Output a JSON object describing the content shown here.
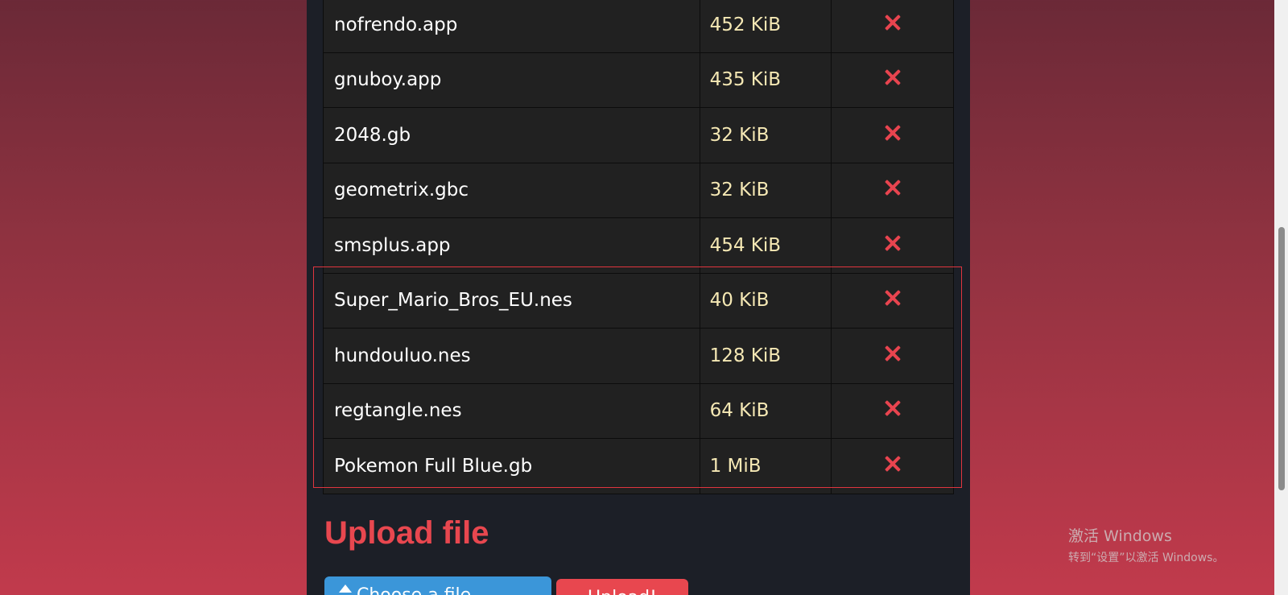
{
  "files": [
    {
      "name": "nofrendo.app",
      "size": "452 KiB"
    },
    {
      "name": "gnuboy.app",
      "size": "435 KiB"
    },
    {
      "name": "2048.gb",
      "size": "32 KiB"
    },
    {
      "name": "geometrix.gbc",
      "size": "32 KiB"
    },
    {
      "name": "smsplus.app",
      "size": "454 KiB"
    },
    {
      "name": "Super_Mario_Bros_EU.nes",
      "size": "40 KiB"
    },
    {
      "name": "hundouluo.nes",
      "size": "128 KiB"
    },
    {
      "name": "regtangle.nes",
      "size": "64 KiB"
    },
    {
      "name": "Pokemon Full Blue.gb",
      "size": "1 MiB"
    }
  ],
  "upload": {
    "title": "Upload file",
    "choose_label": "Choose a file",
    "upload_label": "Upload!"
  },
  "watermark": {
    "line1": "激活 Windows",
    "line2": "转到“设置”以激活 Windows。"
  },
  "colors": {
    "accent": "#e8474f",
    "size_text": "#f5e8b4",
    "choose_button": "#3b96d9",
    "highlight_border": "#e0353f"
  },
  "icons": {
    "delete": "x-icon",
    "upload": "upload-arrow-icon"
  }
}
